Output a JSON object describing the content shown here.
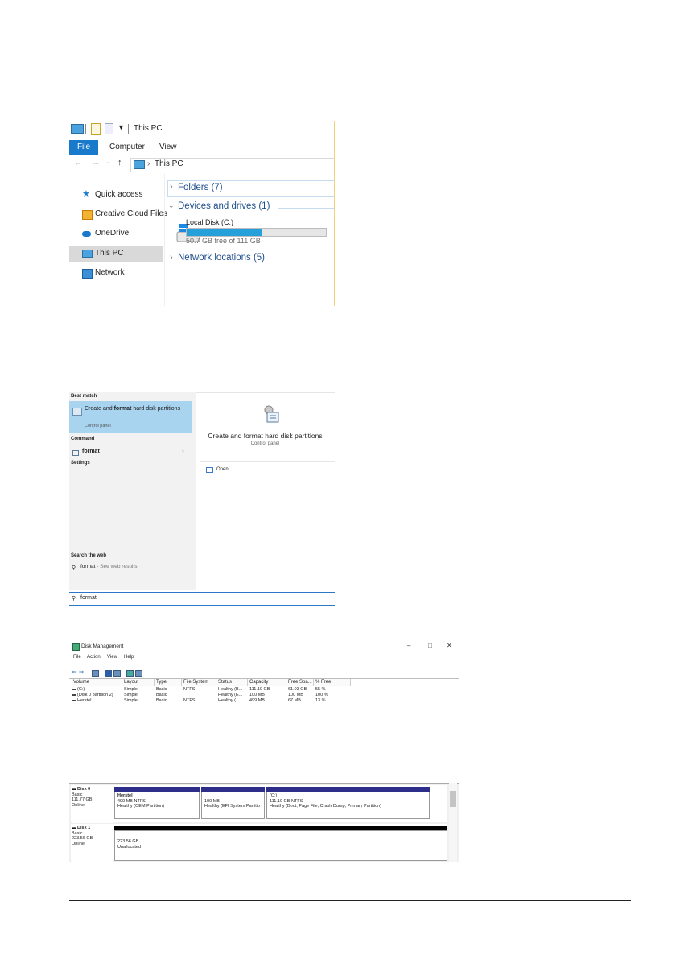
{
  "explorer": {
    "title": "This PC",
    "ribbon_tabs": [
      "File",
      "Computer",
      "View"
    ],
    "address": "This PC",
    "nav": [
      "Quick access",
      "Creative Cloud Files",
      "OneDrive",
      "This PC",
      "Network"
    ],
    "sections": {
      "folders": "Folders (7)",
      "devices": "Devices and drives (1)",
      "network": "Network locations (5)"
    },
    "drive": {
      "name": "Local Disk (C:)",
      "free_text": "50.7 GB free of 111 GB",
      "used_fraction": 0.54
    }
  },
  "search": {
    "best_match_header": "Best match",
    "best_match_pre": "Create and ",
    "best_match_bold": "format",
    "best_match_post": " hard disk partitions",
    "best_match_sub": "Control panel",
    "command_header": "Command",
    "command_item": "format",
    "settings_header": "Settings",
    "web_header": "Search the web",
    "web_query": "format",
    "web_suffix": "- See web results",
    "detail_title": "Create and format hard disk partitions",
    "detail_sub": "Control panel",
    "open_label": "Open",
    "query": "format"
  },
  "diskmgmt": {
    "title": "Disk Management",
    "menu": [
      "File",
      "Action",
      "View",
      "Help"
    ],
    "columns": [
      "Volume",
      "Layout",
      "Type",
      "File System",
      "Status",
      "Capacity",
      "Free Spa...",
      "% Free"
    ],
    "rows": [
      [
        "(C:)",
        "Simple",
        "Basic",
        "NTFS",
        "Healthy (B...",
        "111.19 GB",
        "61.03 GB",
        "55 %"
      ],
      [
        "(Disk 0 partition 2)",
        "Simple",
        "Basic",
        "",
        "Healthy (E...",
        "100 MB",
        "100 MB",
        "100 %"
      ],
      [
        "Herstel",
        "Simple",
        "Basic",
        "NTFS",
        "Healthy (...",
        "499 MB",
        "67 MB",
        "13 %"
      ]
    ],
    "disk0": {
      "name": "Disk 0",
      "type": "Basic",
      "size": "111.77 GB",
      "state": "Online"
    },
    "disk0_parts": [
      {
        "name": "Herstel",
        "size": "499 MB NTFS",
        "status": "Healthy (OEM Partition)"
      },
      {
        "name": "",
        "size": "100 MB",
        "status": "Healthy (EFI System Partitio"
      },
      {
        "name": "(C:)",
        "size": "111.19 GB NTFS",
        "status": "Healthy (Boot, Page File, Crash Dump, Primary Partition)"
      }
    ],
    "disk1": {
      "name": "Disk 1",
      "type": "Basic",
      "size": "223.56 GB",
      "state": "Online"
    },
    "disk1_part": {
      "size": "223.56 GB",
      "status": "Unallocated"
    }
  },
  "colors": {
    "accent": "#1979ca",
    "drive_bar": "#26a0da",
    "partition_bar": "#2c2e8a",
    "selection": "#a8d4f0"
  }
}
